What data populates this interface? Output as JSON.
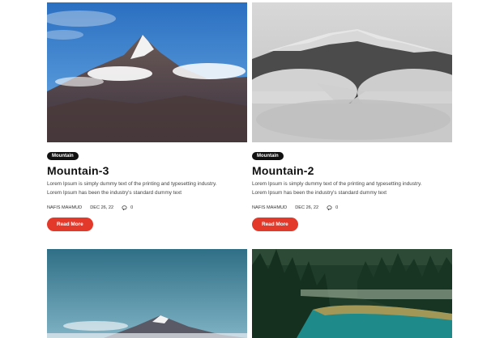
{
  "posts": [
    {
      "category": "Mountain",
      "title": "Mountain-3",
      "excerpt_line1": "Lorem Ipsum is simply dummy text of the printing and typesetting industry.",
      "excerpt_line2": "Lorem Ipsum has been the industry's standard dummy text",
      "author": "Nafis Mahmud",
      "date": "Dec 26, 22",
      "comments": "0",
      "button": "Read More"
    },
    {
      "category": "Mountain",
      "title": "Mountain-2",
      "excerpt_line1": "Lorem Ipsum is simply dummy text of the printing and typesetting industry.",
      "excerpt_line2": "Lorem Ipsum has been the industry's standard dummy text",
      "author": "Nafis Mahmud",
      "date": "Dec 26, 22",
      "comments": "0",
      "button": "Read More"
    }
  ],
  "colors": {
    "accent": "#e3392b",
    "tag_bg": "#111111"
  },
  "icons": {
    "comment": "comment-icon"
  }
}
